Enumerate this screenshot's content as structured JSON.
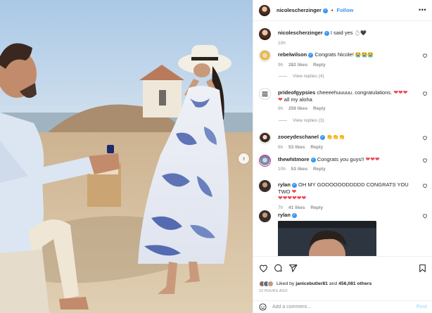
{
  "post": {
    "username": "nicolescherzinger",
    "follow_label": "Follow",
    "more_label": "•••",
    "dot": "•"
  },
  "caption": {
    "username": "nicolescherzinger",
    "text": "I said yes",
    "emoji": "💍🖤",
    "time": "10h"
  },
  "comments": [
    {
      "username": "rebelwilson",
      "text": "Congrats Nicole!",
      "emoji": "😭😭😭",
      "time": "9h",
      "likes": "282 likes",
      "reply": "Reply",
      "view_replies": "View replies (4)"
    },
    {
      "username": "prideofgypsies",
      "text": "cheeeehuuuuu. congratulations.",
      "emoji": "❤❤❤",
      "text2": "all my aloha",
      "emoji_pre": "❤",
      "time": "9h",
      "likes": "259 likes",
      "reply": "Reply",
      "view_replies": "View replies (3)"
    },
    {
      "username": "zooeydeschanel",
      "text": "",
      "emoji": "👏👏👏",
      "time": "6h",
      "likes": "53 likes",
      "reply": "Reply"
    },
    {
      "username": "thewhitmore",
      "text": "Congrats you guys!!",
      "emoji": "❤❤❤",
      "time": "10h",
      "likes": "53 likes",
      "reply": "Reply"
    },
    {
      "username": "rylan",
      "text": "OH MY GOOOOOODDDDD CONGRATS YOU TWO",
      "emoji": "❤",
      "text2": "",
      "emoji2": "❤❤❤❤❤❤",
      "time": "7h",
      "likes": "41 likes",
      "reply": "Reply"
    },
    {
      "username": "rylan",
      "text": ""
    }
  ],
  "likes": {
    "prefix": "Liked by",
    "user": "janicebutler81",
    "and": "and",
    "count": "456,081 others"
  },
  "timestamp": "10 HOURS AGO",
  "add_comment": {
    "placeholder": "Add a comment...",
    "post_label": "Post"
  },
  "icons": {
    "heart": "heart-icon",
    "comment": "comment-icon",
    "share": "share-icon",
    "save": "bookmark-icon",
    "emoji": "emoji-icon",
    "next": "chevron-right-icon",
    "more": "more-icon"
  },
  "colors": {
    "link": "#3897f0",
    "heart": "#ed4956",
    "muted": "#8e8e8e"
  }
}
